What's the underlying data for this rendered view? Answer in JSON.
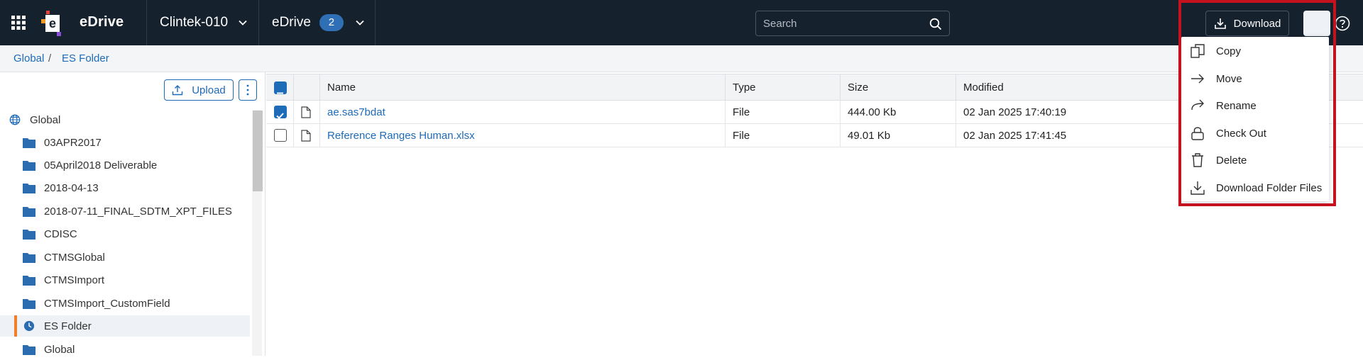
{
  "app": {
    "title": "eDrive"
  },
  "header": {
    "workspace_label": "Clintek-010",
    "module_label": "eDrive",
    "module_badge": "2",
    "search_placeholder": "Search",
    "download_label": "Download"
  },
  "breadcrumb": [
    "Global",
    "ES Folder"
  ],
  "breadcrumb_sep": "/",
  "sidebar": {
    "upload_label": "Upload",
    "root_label": "Global",
    "items": [
      {
        "label": "03APR2017",
        "icon": "folder-icon"
      },
      {
        "label": "05April2018 Deliverable",
        "icon": "folder-icon"
      },
      {
        "label": "2018-04-13",
        "icon": "folder-icon"
      },
      {
        "label": "2018-07-11_FINAL_SDTM_XPT_FILES",
        "icon": "folder-icon"
      },
      {
        "label": "CDISC",
        "icon": "folder-icon"
      },
      {
        "label": "CTMSGlobal",
        "icon": "folder-icon"
      },
      {
        "label": "CTMSImport",
        "icon": "folder-icon"
      },
      {
        "label": "CTMSImport_CustomField",
        "icon": "folder-icon"
      },
      {
        "label": "ES Folder",
        "icon": "clock-icon",
        "active": true
      },
      {
        "label": "Global",
        "icon": "folder-icon"
      }
    ]
  },
  "table": {
    "headers": {
      "name": "Name",
      "type": "Type",
      "size": "Size",
      "modified": "Modified"
    },
    "rows": [
      {
        "name": "ae.sas7bdat",
        "type": "File",
        "size": "444.00 Kb",
        "modified": "02 Jan 2025 17:40:19",
        "checked": true
      },
      {
        "name": "Reference Ranges Human.xlsx",
        "type": "File",
        "size": "49.01 Kb",
        "modified": "02 Jan 2025 17:41:45",
        "checked": false
      }
    ]
  },
  "menu": {
    "items": [
      {
        "label": "Copy",
        "icon": "copy-icon"
      },
      {
        "label": "Move",
        "icon": "arrow-right-icon"
      },
      {
        "label": "Rename",
        "icon": "redo-icon"
      },
      {
        "label": "Check Out",
        "icon": "lock-icon"
      },
      {
        "label": "Delete",
        "icon": "trash-icon"
      },
      {
        "label": "Download Folder Files",
        "icon": "download-icon"
      }
    ]
  },
  "colors": {
    "topbar": "#16212e",
    "accent": "#1e6bb8",
    "active_marker": "#f07f2c",
    "highlight": "#c4131f"
  }
}
